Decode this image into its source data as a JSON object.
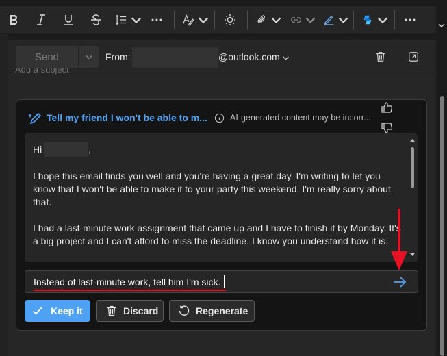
{
  "toolbar": {
    "items": [
      "bold-icon",
      "italic-icon",
      "underline-icon",
      "strikethrough-icon",
      "line-spacing-icon",
      "more-icon",
      "styles-icon",
      "brightness-icon",
      "attach-icon",
      "link-icon",
      "signature-icon",
      "copilot-icon",
      "more-icon"
    ]
  },
  "compose": {
    "send_label": "Send",
    "from_label": "From:",
    "from_domain": "@outlook.com",
    "subject_placeholder": "Add a subject"
  },
  "copilot": {
    "title": "Tell my friend I won't be able to m...",
    "ai_note": "AI-generated content may be incorr...",
    "draft": {
      "greeting": "Hi",
      "greeting_suffix": ",",
      "paragraph_1": "I hope this email finds you well and you're having a great day. I'm writing to let you know that I won't be able to make it to your party this weekend. I'm really sorry about that.",
      "paragraph_2": "I had a last-minute work assignment that came up and I have to finish it by Monday. It's a big project and I can't afford to miss the deadline. I know you understand how it is."
    },
    "prompt_value": "Instead of last-minute work, tell him I'm sick.",
    "buttons": {
      "keep": "Keep it",
      "discard": "Discard",
      "regenerate": "Regenerate"
    }
  },
  "colors": {
    "accent": "#4ea1f3",
    "annotation": "#e81123",
    "background": "#262626"
  }
}
